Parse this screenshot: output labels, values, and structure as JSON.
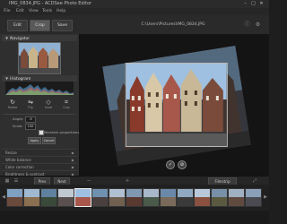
{
  "window": {
    "title": "IMG_0834.JPG - ACDSee Photo Editor",
    "controls": [
      "–",
      "□",
      "✕"
    ]
  },
  "menu": [
    "File",
    "Edit",
    "View",
    "Tools",
    "Help"
  ],
  "toolbar": {
    "buttons": [
      "Edit",
      "Crop",
      "Save"
    ],
    "filename": "C:\\Users\\Pictures\\IMG_0834.JPG",
    "icons": [
      "info-icon",
      "settings-icon"
    ]
  },
  "panel": {
    "navigator_label": "Navigator",
    "histogram_label": "Histogram",
    "tools": [
      {
        "icon": "rotate-icon",
        "label": "Rotate",
        "glyph": "↻"
      },
      {
        "icon": "flip-icon",
        "label": "Flip",
        "glyph": "⇋"
      },
      {
        "icon": "straighten-icon",
        "label": "Level",
        "glyph": "◇"
      },
      {
        "icon": "crop-icon",
        "label": "Crop",
        "glyph": "⌗"
      }
    ],
    "angle_label": "Angle:",
    "angle_value": "-9",
    "scale_label": "Scale:",
    "scale_value": "100",
    "constrain_label": "Maintain proportions",
    "apply_label": "Apply",
    "cancel_label": "Cancel",
    "collapsed_sections": [
      "Resize",
      "White balance",
      "Color correction",
      "Brightness & contrast"
    ]
  },
  "canvas": {
    "confirm_icon": "check-icon",
    "cancel_icon": "cancel-icon"
  },
  "filmstrip_bar": {
    "buttons": [
      "Prev",
      "Next"
    ],
    "right_label": "Filmstrip"
  },
  "filmstrip": {
    "count": 15,
    "selected_index": 5
  },
  "colors": {
    "accent": "#5a5a5a",
    "background": "#1e1e1e",
    "panel": "#2f2f2f"
  }
}
